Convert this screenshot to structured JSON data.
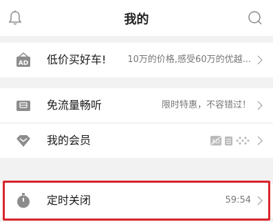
{
  "header": {
    "title": "我的",
    "left_icon": "bell-icon",
    "right_icon": "search-icon"
  },
  "rows": [
    {
      "icon": "car-ad-icon",
      "label": "低价买好车!",
      "value": "10万的价格,感受60万的优越..."
    },
    {
      "icon": "sim-card-icon",
      "label": "免流量畅听",
      "value": "限时特惠，不容错过！"
    },
    {
      "icon": "diamond-icon",
      "label": "我的会员",
      "value": ""
    },
    {
      "icon": "timer-icon",
      "label": "定时关闭",
      "value": "59:54"
    }
  ],
  "colors": {
    "icon_gray": "#8c8c8c",
    "highlight_red": "#d9232b",
    "background": "#f2f2f2"
  }
}
